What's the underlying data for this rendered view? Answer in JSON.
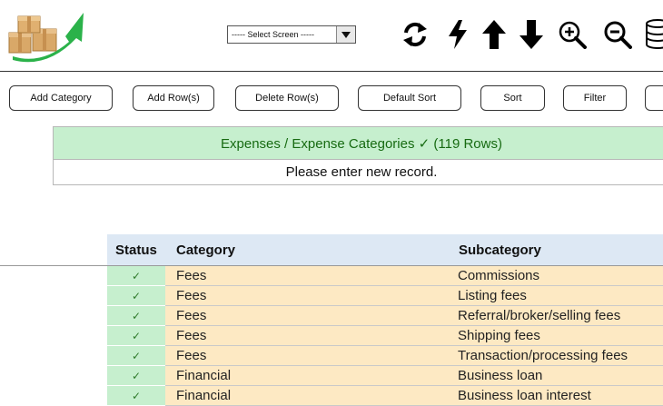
{
  "toolbar": {
    "select_screen": "----- Select Screen -----",
    "icons": [
      "refresh-icon",
      "lightning-icon",
      "arrow-up-icon",
      "arrow-down-icon",
      "zoom-in-icon",
      "zoom-out-icon",
      "database-icon"
    ]
  },
  "buttons": {
    "add_category": "Add Category",
    "add_rows": "Add Row(s)",
    "delete_rows": "Delete Row(s)",
    "default_sort": "Default Sort",
    "sort": "Sort",
    "filter": "Filter"
  },
  "banner": {
    "title": "Expenses / Expense Categories ✓ (119 Rows)",
    "notice": "Please enter new record."
  },
  "table": {
    "headers": {
      "status": "Status",
      "category": "Category",
      "subcategory": "Subcategory"
    },
    "rows": [
      {
        "status": "✓",
        "category": "Fees",
        "subcategory": "Commissions"
      },
      {
        "status": "✓",
        "category": "Fees",
        "subcategory": "Listing fees"
      },
      {
        "status": "✓",
        "category": "Fees",
        "subcategory": "Referral/broker/selling fees"
      },
      {
        "status": "✓",
        "category": "Fees",
        "subcategory": "Shipping fees"
      },
      {
        "status": "✓",
        "category": "Fees",
        "subcategory": "Transaction/processing fees"
      },
      {
        "status": "✓",
        "category": "Financial",
        "subcategory": "Business loan"
      },
      {
        "status": "✓",
        "category": "Financial",
        "subcategory": "Business loan interest"
      }
    ]
  },
  "colors": {
    "status_green": "#c6efce",
    "cell_yellow": "#fde9c3",
    "header_blue": "#dde8f4",
    "banner_text": "#176b12"
  }
}
